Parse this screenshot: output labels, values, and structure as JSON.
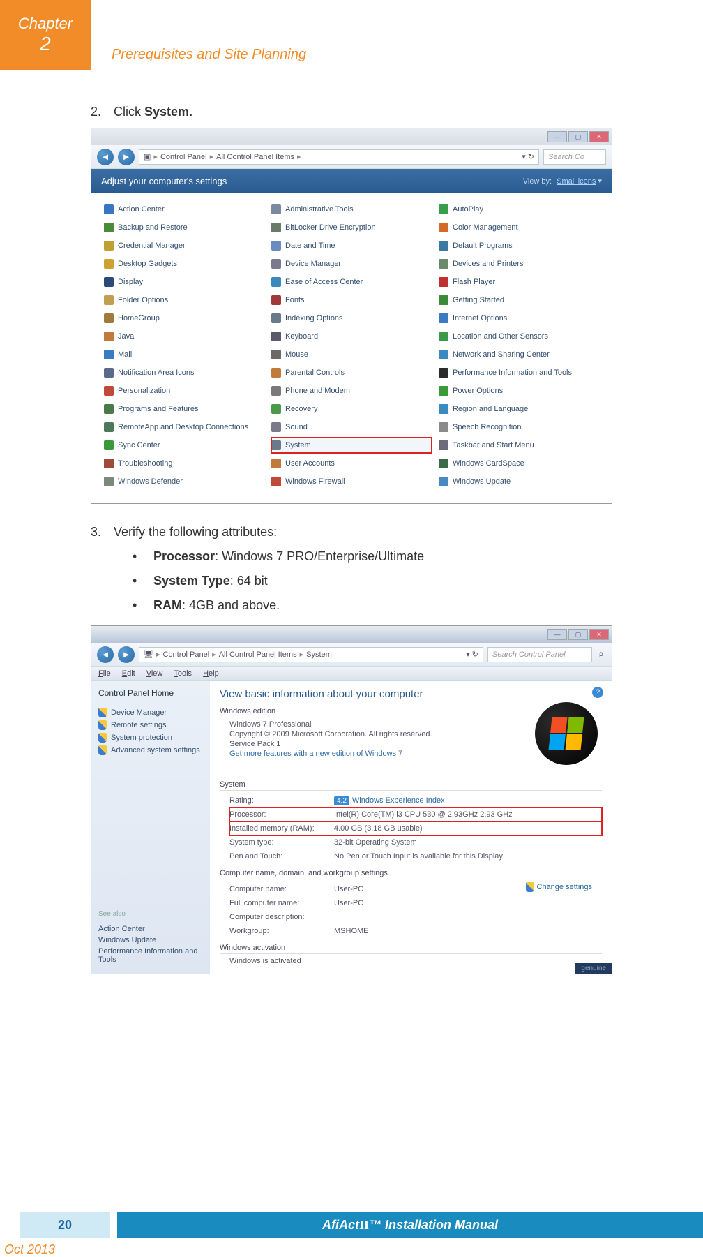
{
  "header": {
    "chapter_label": "Chapter",
    "chapter_number": "2",
    "section_title": "Prerequisites and Site Planning"
  },
  "content": {
    "step2": {
      "num": "2.",
      "pre": "Click ",
      "bold": "System."
    },
    "step3": {
      "num": "3.",
      "text": "Verify the following attributes:"
    },
    "bullets": [
      {
        "bold": "Processor",
        "rest": ": Windows 7 PRO/Enterprise/Ultimate"
      },
      {
        "bold": "System Type",
        "rest": ": 64 bit"
      },
      {
        "bold": "RAM",
        "rest": ": 4GB and above."
      }
    ]
  },
  "cp": {
    "breadcrumb": [
      "Control Panel",
      "All Control Panel Items"
    ],
    "search_placeholder": "Search Co",
    "adjust": "Adjust your computer's settings",
    "viewby_label": "View by:",
    "viewby_value": "Small icons",
    "items": [
      "Action Center",
      "Administrative Tools",
      "AutoPlay",
      "Backup and Restore",
      "BitLocker Drive Encryption",
      "Color Management",
      "Credential Manager",
      "Date and Time",
      "Default Programs",
      "Desktop Gadgets",
      "Device Manager",
      "Devices and Printers",
      "Display",
      "Ease of Access Center",
      "Flash Player",
      "Folder Options",
      "Fonts",
      "Getting Started",
      "HomeGroup",
      "Indexing Options",
      "Internet Options",
      "Java",
      "Keyboard",
      "Location and Other Sensors",
      "Mail",
      "Mouse",
      "Network and Sharing Center",
      "Notification Area Icons",
      "Parental Controls",
      "Performance Information and Tools",
      "Personalization",
      "Phone and Modem",
      "Power Options",
      "Programs and Features",
      "Recovery",
      "Region and Language",
      "RemoteApp and Desktop Connections",
      "Sound",
      "Speech Recognition",
      "Sync Center",
      "System",
      "Taskbar and Start Menu",
      "Troubleshooting",
      "User Accounts",
      "Windows CardSpace",
      "Windows Defender",
      "Windows Firewall",
      "Windows Update"
    ],
    "icon_colors": [
      "#3876c4",
      "#7a8aa0",
      "#3a9d4a",
      "#4a8a3a",
      "#6a7a6a",
      "#d46a2a",
      "#c0a030",
      "#6a8ac0",
      "#3a7aa0",
      "#d0a030",
      "#7a7a8a",
      "#6a8a6a",
      "#2a4a7a",
      "#3a8ac0",
      "#c03030",
      "#c0a050",
      "#a03a3a",
      "#3a8a3a",
      "#a07a3a",
      "#6a7a8a",
      "#3a7ac0",
      "#c07a3a",
      "#5a5a6a",
      "#3a9a4a",
      "#3a7ac0",
      "#6a6a6a",
      "#3a8ac0",
      "#5a6a8a",
      "#c07a3a",
      "#2a2a2a",
      "#c04a3a",
      "#7a7a7a",
      "#3a9a3a",
      "#4a7a4a",
      "#4a9a4a",
      "#3a8ac0",
      "#4a7a5a",
      "#7a7a8a",
      "#8a8a8a",
      "#3a9a3a",
      "#6a7a8a",
      "#6a6a7a",
      "#a04a3a",
      "#c07a3a",
      "#3a6a4a",
      "#7a8a7a",
      "#c04a3a",
      "#4a8ac0"
    ],
    "highlight_index": 40
  },
  "sys": {
    "breadcrumb": [
      "Control Panel",
      "All Control Panel Items",
      "System"
    ],
    "search_placeholder": "Search Control Panel",
    "menu": [
      "File",
      "Edit",
      "View",
      "Tools",
      "Help"
    ],
    "side_title": "Control Panel Home",
    "side_links": [
      "Device Manager",
      "Remote settings",
      "System protection",
      "Advanced system settings"
    ],
    "side_seealso": "See also",
    "side_subs": [
      "Action Center",
      "Windows Update",
      "Performance Information and Tools"
    ],
    "main_title": "View basic information about your computer",
    "win_edition": "Windows edition",
    "edition_lines": [
      "Windows 7 Professional",
      "Copyright © 2009 Microsoft Corporation.  All rights reserved.",
      "Service Pack 1"
    ],
    "edition_link": "Get more features with a new edition of Windows 7",
    "system_label": "System",
    "specs": [
      {
        "label": "Rating:",
        "val": "",
        "wei": "4.2",
        "link": "Windows Experience Index",
        "hl": false
      },
      {
        "label": "Processor:",
        "val": "Intel(R) Core(TM) i3 CPU        530  @ 2.93GHz  2.93 GHz",
        "hl": true
      },
      {
        "label": "Installed memory (RAM):",
        "val": "4.00 GB (3.18 GB usable)",
        "hl": true
      },
      {
        "label": "System type:",
        "val": "32-bit Operating System",
        "hl": false
      },
      {
        "label": "Pen and Touch:",
        "val": "No Pen or Touch Input is available for this Display",
        "hl": false
      }
    ],
    "comp_label": "Computer name, domain, and workgroup settings",
    "comp_rows": [
      {
        "label": "Computer name:",
        "val": "User-PC"
      },
      {
        "label": "Full computer name:",
        "val": "User-PC"
      },
      {
        "label": "Computer description:",
        "val": ""
      },
      {
        "label": "Workgroup:",
        "val": "MSHOME"
      }
    ],
    "change_settings": "Change settings",
    "activation_label": "Windows activation",
    "activation_text": "Windows is activated",
    "genuine": "genuine"
  },
  "footer": {
    "page_num": "20",
    "manual_pre": "AfiAct ",
    "manual_roman": "II",
    "manual_post": "™ Installation Manual",
    "date": "Oct 2013"
  }
}
